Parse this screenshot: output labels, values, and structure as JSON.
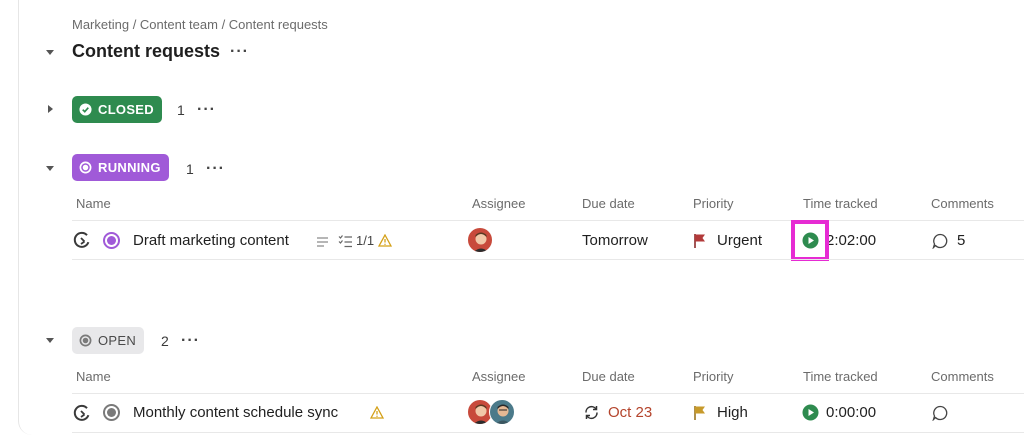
{
  "breadcrumb": "Marketing / Content team / Content requests",
  "list_title": "Content requests",
  "icons": {
    "collapse": "caret-down-icon",
    "expand": "caret-right-icon",
    "more": "more-dots-icon",
    "task_status": "circle-status-icon",
    "subtask_type": "task-type-icon",
    "description": "description-lines-icon",
    "checklist": "checklist-icon",
    "warning": "warning-triangle-icon",
    "flag": "flag-icon",
    "play": "play-timer-icon",
    "comment": "comment-bubble-icon",
    "recurring": "recurring-arrows-icon"
  },
  "columns": {
    "name": "Name",
    "assignee": "Assignee",
    "due_date": "Due date",
    "priority": "Priority",
    "time_tracked": "Time tracked",
    "comments": "Comments"
  },
  "groups": [
    {
      "status": "CLOSED",
      "count": "1",
      "color": "#2e8b4f",
      "collapsed": true
    },
    {
      "status": "RUNNING",
      "count": "1",
      "color": "#a05ad8",
      "collapsed": false,
      "tasks": [
        {
          "name": "Draft marketing content",
          "checklist": "1/1",
          "due_date": "Tomorrow",
          "priority": "Urgent",
          "priority_color": "#b23a3a",
          "time_tracked": "2:02:00",
          "comments": "5"
        }
      ]
    },
    {
      "status": "OPEN",
      "count": "2",
      "color": "#8a8a8a",
      "collapsed": false,
      "tasks": [
        {
          "name": "Monthly content schedule sync",
          "due_date": "Oct 23",
          "due_color": "#b4442c",
          "priority": "High",
          "priority_color": "#c79a2b",
          "time_tracked": "0:00:00",
          "comments": ""
        }
      ]
    }
  ]
}
